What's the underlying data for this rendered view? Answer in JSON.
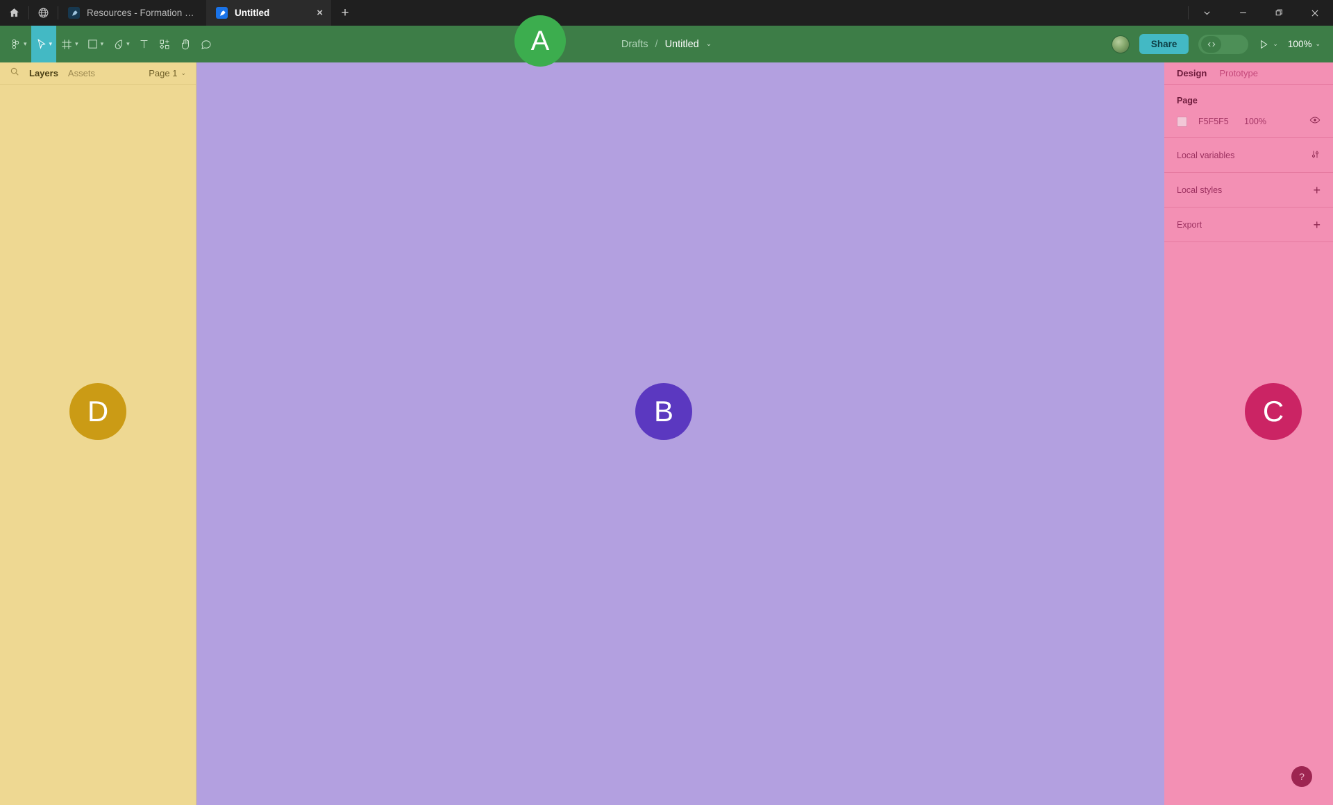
{
  "browser": {
    "home_icon": "home-icon",
    "globe_icon": "globe-icon",
    "tabs": [
      {
        "title": "Resources - Formation FIGMA",
        "active": false,
        "favicon": "figma-favicon"
      },
      {
        "title": "Untitled",
        "active": true,
        "favicon": "figma-favicon",
        "close_label": "×"
      }
    ],
    "new_tab_label": "+",
    "window_controls": {
      "expand_label": "⌄",
      "minimize_label": "—",
      "restore_label": "❐",
      "close_label": "×"
    }
  },
  "toolbar": {
    "tools": [
      {
        "name": "figma-menu",
        "icon": "figma-logo-icon",
        "caret": true,
        "active": false
      },
      {
        "name": "move-tool",
        "icon": "cursor-arrow-icon",
        "caret": true,
        "active": true
      },
      {
        "name": "frame-tool",
        "icon": "frame-icon",
        "caret": true,
        "active": false
      },
      {
        "name": "shape-tool",
        "icon": "rectangle-icon",
        "caret": true,
        "active": false
      },
      {
        "name": "pen-tool",
        "icon": "pen-icon",
        "caret": true,
        "active": false
      },
      {
        "name": "text-tool",
        "icon": "text-icon",
        "caret": false,
        "active": false
      },
      {
        "name": "actions-tool",
        "icon": "components-icon",
        "caret": false,
        "active": false
      },
      {
        "name": "hand-tool",
        "icon": "hand-icon",
        "caret": false,
        "active": false
      },
      {
        "name": "comment-tool",
        "icon": "comment-icon",
        "caret": false,
        "active": false
      }
    ],
    "breadcrumb": {
      "parent": "Drafts",
      "separator": "/",
      "current": "Untitled",
      "caret": "⌄"
    },
    "avatar": "user-avatar",
    "share_label": "Share",
    "dev_mode_icon": "code-icon",
    "dev_mode_label": "</>",
    "present_icon": "play-icon",
    "present_caret": "⌄",
    "zoom_level": "100%",
    "zoom_caret": "⌄",
    "accent_color": "#43b9c4",
    "bar_color": "#3d7d47"
  },
  "left_panel": {
    "background_color": "#eed892",
    "search_icon": "search-icon",
    "tabs": [
      {
        "label": "Layers",
        "active": true
      },
      {
        "label": "Assets",
        "active": false
      }
    ],
    "page_selector": {
      "label": "Page 1",
      "caret": "⌄"
    },
    "artboard": {
      "letter": "D",
      "color": "#cb9b15"
    }
  },
  "canvas": {
    "background_color": "#b3a0e0",
    "artboard": {
      "letter": "B",
      "color": "#5b38c0"
    }
  },
  "right_panel": {
    "background_color": "#f390b4",
    "tabs": [
      {
        "label": "Design",
        "active": true
      },
      {
        "label": "Prototype",
        "active": false
      }
    ],
    "page_section": {
      "label": "Page",
      "swatch_color": "#f2c7d7",
      "hex": "F5F5F5",
      "opacity": "100%",
      "visibility_icon": "eye-icon"
    },
    "rows": [
      {
        "label": "Local variables",
        "action_icon": "sliders-icon",
        "action_label": ""
      },
      {
        "label": "Local styles",
        "action_icon": "plus-icon",
        "action_label": "+"
      },
      {
        "label": "Export",
        "action_icon": "plus-icon",
        "action_label": "+"
      }
    ],
    "artboard": {
      "letter": "C",
      "color": "#cb2464"
    },
    "help_label": "?"
  },
  "overlay": {
    "cursor_avatar": {
      "letter": "A",
      "color": "#3cad4e"
    }
  }
}
